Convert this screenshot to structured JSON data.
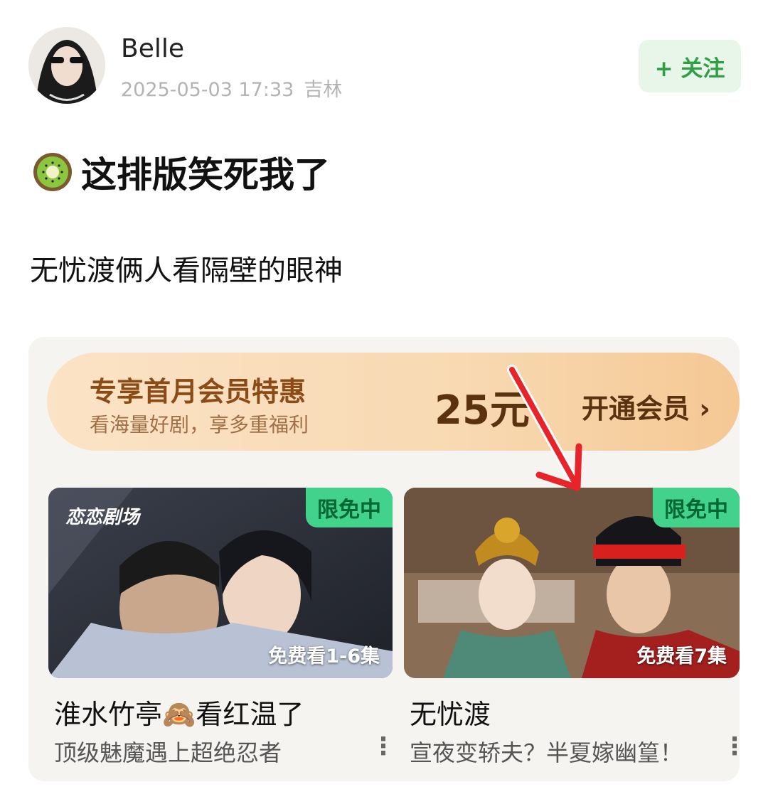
{
  "post": {
    "username": "Belle",
    "timestamp": "2025-05-03 17:33",
    "location": "吉林",
    "follow_label": "+ 关注",
    "line1": "这排版笑死我了",
    "line2": "无忧渡俩人看隔壁的眼神",
    "emoji_icon": "kiwi-icon"
  },
  "screenshot": {
    "banner": {
      "title": "专享首月会员特惠",
      "subtitle": "看海量好剧，享多重福利",
      "price": "25元",
      "button": "开通会员 ›"
    },
    "cards": [
      {
        "tag": "限免中",
        "episodes": "免费看1-6集",
        "title": "淮水竹亭🙈看红温了",
        "desc": "顶级魅魔遇上超绝忍者",
        "watermark": "恋恋剧场"
      },
      {
        "tag": "限免中",
        "episodes": "免费看7集",
        "title": "无忧渡",
        "desc": "宣夜变轿夫？半夏嫁幽篁！"
      }
    ],
    "more_icon": "⋮",
    "colors": {
      "tag_green": "#43d28c",
      "follow_green": "#2f9e44",
      "banner_brown": "#8a4b17",
      "arrow_red": "#e8242b"
    }
  }
}
